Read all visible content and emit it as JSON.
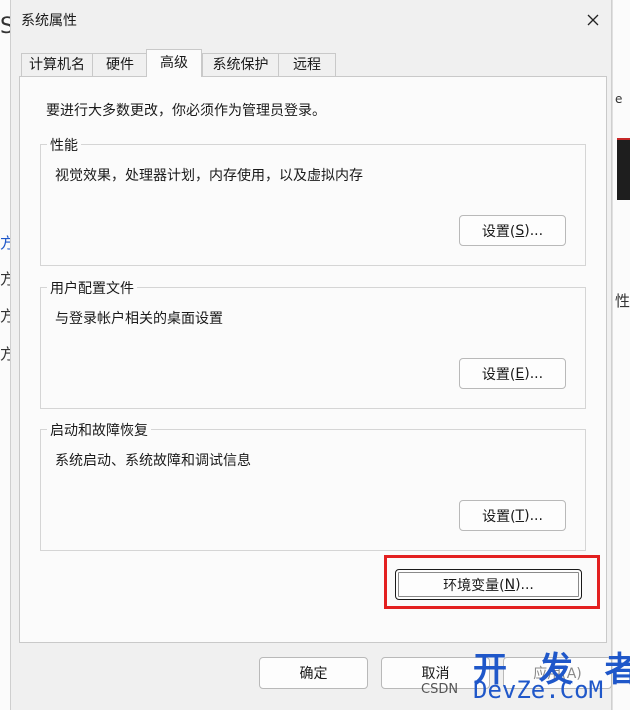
{
  "window": {
    "title": "系统属性"
  },
  "tabs": [
    {
      "label": "计算机名"
    },
    {
      "label": "硬件"
    },
    {
      "label": "高级"
    },
    {
      "label": "系统保护"
    },
    {
      "label": "远程"
    }
  ],
  "admin_note": "要进行大多数更改，你必须作为管理员登录。",
  "groups": {
    "performance": {
      "title": "性能",
      "desc": "视觉效果，处理器计划，内存使用，以及虚拟内存",
      "button": {
        "pre": "设置(",
        "key": "S",
        "post": ")..."
      }
    },
    "user_profiles": {
      "title": "用户配置文件",
      "desc": "与登录帐户相关的桌面设置",
      "button": {
        "pre": "设置(",
        "key": "E",
        "post": ")..."
      }
    },
    "startup_recovery": {
      "title": "启动和故障恢复",
      "desc": "系统启动、系统故障和调试信息",
      "button": {
        "pre": "设置(",
        "key": "T",
        "post": ")..."
      }
    }
  },
  "env_button": {
    "pre": "环境变量(",
    "key": "N",
    "post": ")..."
  },
  "footer": {
    "ok": "确定",
    "cancel": "取消",
    "apply": "应用(A)"
  },
  "background": {
    "left_frags": [
      "S",
      "方",
      "方",
      "方",
      "方"
    ],
    "right_frags": [
      "е",
      "性"
    ]
  },
  "watermark": {
    "top": "开 发 者",
    "csdn": "CSDN",
    "bottom": "DevZe.CoM"
  },
  "colors": {
    "highlight": "#e32020",
    "watermark": "#1f57c9"
  }
}
